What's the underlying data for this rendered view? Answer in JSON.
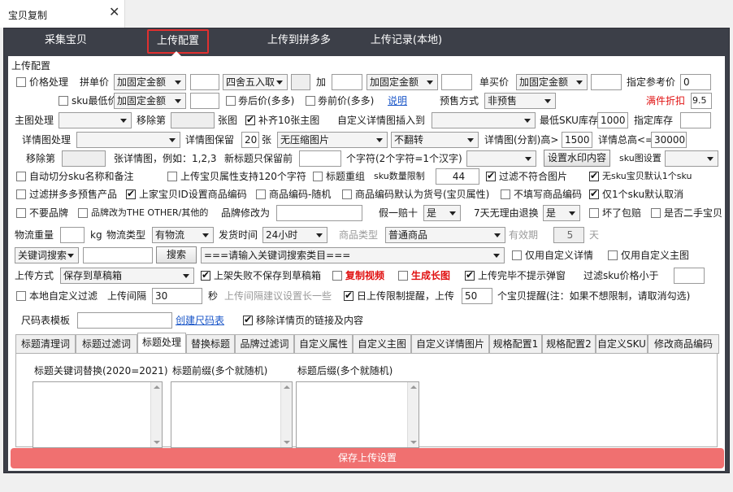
{
  "window": {
    "tab_title": "宝贝复制",
    "close": "✕"
  },
  "nav": {
    "items": [
      "采集宝贝",
      "上传配置",
      "上传到拼多多",
      "上传记录(本地)"
    ],
    "active_index": 1
  },
  "section_title": "上传配置",
  "row1": {
    "price_processing": "价格处理",
    "single_price": "拼单价",
    "single_price_mode": "加固定金额",
    "single_price_value": "",
    "rounding": "四舍五入取",
    "rounding_value": "",
    "plus": "加",
    "plus_value": "",
    "plus_mode": "加固定金额",
    "plus_mode_value": "",
    "unit_price": "单买价",
    "unit_price_mode": "加固定金额",
    "unit_price_value": "",
    "ref_price": "指定参考价",
    "ref_price_value": "0"
  },
  "row2": {
    "sku_min_price": "sku最低价",
    "sku_min_mode": "加固定金额",
    "sku_min_value": "",
    "after_coupon": "劵后价(多多)",
    "coupon_price": "劵前价(多多)",
    "help": "说明",
    "presale": "预售方式",
    "presale_value": "非预售",
    "discount": "满件折扣",
    "discount_value": "9.5"
  },
  "row3": {
    "main_img": "主图处理",
    "main_img_mode": "",
    "remove": "移除第",
    "remove_value": "",
    "img_unit": "张图",
    "fill10": "补齐10张主图",
    "custom_detail": "自定义详情图插入到",
    "custom_detail_value": "",
    "min_sku_stock": "最低SKU库存",
    "min_sku_stock_value": "1000",
    "stock": "指定库存",
    "stock_value": ""
  },
  "row4": {
    "detail_img": "详情图处理",
    "detail_img_mode": "",
    "keep": "详情图保留",
    "keep_value": "20",
    "zhang": "张",
    "compress": "无压缩图片",
    "flip": "不翻转",
    "split_height": "详情图(分割)高>",
    "split_height_value": "1500",
    "total_height": "详情总高<=",
    "total_height_value": "30000"
  },
  "row5": {
    "remove": "移除第",
    "remove_value": "",
    "example": "张详情图，例如：1,2,3",
    "title_keep": "新标题只保留前",
    "title_keep_value": "",
    "chars": "个字符(2个字符=1个汉字)",
    "chars_select": "",
    "watermark": "设置水印内容",
    "sku_img": "sku图设置",
    "sku_img_value": ""
  },
  "row6": {
    "auto_split": "自动切分sku名称和备注",
    "attr120": "上传宝贝属性支持120个字符",
    "title_regroup": "标题重组",
    "sku_limit": "sku数量限制",
    "sku_limit_value": "44",
    "filter_img": "过滤不符合图片",
    "no_sku_default": "无sku宝贝默认1个sku"
  },
  "row7": {
    "filter_presale": "过滤拼多多预售产品",
    "use_id_code": "上家宝贝ID设置商品编码",
    "random_code": "商品编码-随机",
    "code_default": "商品编码默认为货号(宝贝属性)",
    "no_code": "不填写商品编码",
    "one_sku_cancel": "仅1个sku默认取消"
  },
  "row8": {
    "no_brand": "不要品牌",
    "brand_other": "品牌改为THE OTHER/其他的",
    "brand_change": "品牌修改为",
    "brand_change_value": "",
    "fake_ten": "假一赔十",
    "fake_ten_value": "是",
    "seven_days": "7天无理由退换",
    "seven_days_value": "是",
    "broken": "坏了包赔",
    "second_hand": "是否二手宝贝"
  },
  "row9": {
    "logistics_weight": "物流重量",
    "weight_value": "",
    "kg": "kg",
    "logistics_type": "物流类型",
    "logistics_value": "有物流",
    "ship_time": "发货时间",
    "ship_time_value": "24小时",
    "goods_type": "商品类型",
    "goods_type_value": "普通商品",
    "valid": "有效期",
    "valid_value": "5",
    "day": "天"
  },
  "row10": {
    "keyword_search": "关键词搜索",
    "keyword_value": "",
    "search_btn": "搜索",
    "category": "===请输入关键词搜索类目===",
    "custom_detail_only": "仅用自定义详情",
    "custom_main_only": "仅用自定义主图"
  },
  "row11": {
    "upload_mode": "上传方式",
    "upload_mode_value": "保存到草稿箱",
    "fail_no_draft": "上架失败不保存到草稿箱",
    "copy_video": "复制视频",
    "gen_long": "生成长图",
    "no_popup": "上传完毕不提示弹窗",
    "filter_sku": "过滤sku价格小于",
    "filter_sku_value": ""
  },
  "row12": {
    "local_filter": "本地自定义过滤",
    "interval": "上传间隔",
    "interval_value": "30",
    "sec": "秒",
    "interval_tip": "上传间隔建议设置长一些",
    "daily_limit": "日上传限制提醒，上传",
    "daily_limit_value": "50",
    "daily_tip": "个宝贝提醒(注：如果不想限制，请取消勾选)"
  },
  "row13": {
    "size_template": "尺码表模板",
    "size_value": "",
    "create_size": "创建尺码表",
    "remove_links": "移除详情页的链接及内容"
  },
  "subtabs": [
    "标题清理词",
    "标题过滤词",
    "标题处理",
    "替换标题",
    "品牌过滤词",
    "自定义属性",
    "自定义主图",
    "自定义详情图片",
    "规格配置1",
    "规格配置2",
    "自定义SKU",
    "修改商品编码"
  ],
  "subtab_active": 2,
  "title_proc": {
    "keyword_replace": "标题关键词替换(2020=2021)",
    "prefix": "标题前缀(多个就随机)",
    "suffix": "标题后缀(多个就随机)"
  },
  "save": "保存上传设置",
  "colors": {
    "frame": "#3c3f48",
    "save": "#f07070",
    "accent_red": "#e01010",
    "link": "#1a56c8"
  }
}
